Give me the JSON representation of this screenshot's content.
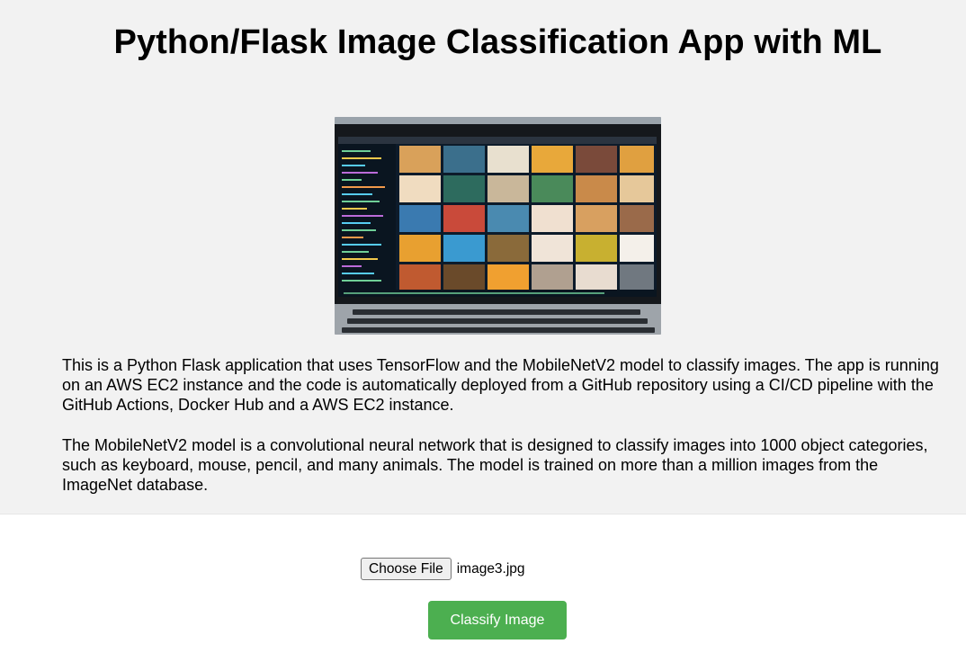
{
  "header": {
    "title": "Python/Flask Image Classification App with ML"
  },
  "hero_image": {
    "description_icon": "laptop-image-grid"
  },
  "description": {
    "paragraph_1": "This is a Python Flask application that uses TensorFlow and the MobileNetV2 model to classify images. The app is running on an AWS EC2 instance and the code is automatically deployed from a GitHub repository using a CI/CD pipeline with the GitHub Actions, Docker Hub and a AWS EC2 instance.",
    "paragraph_2": "The MobileNetV2 model is a convolutional neural network that is designed to classify images into 1000 object categories, such as keyboard, mouse, pencil, and many animals. The model is trained on more than a million images from the ImageNet database."
  },
  "form": {
    "choose_file_label": "Choose File",
    "selected_file": "image3.jpg",
    "classify_label": "Classify Image"
  },
  "colors": {
    "header_background": "#f2f2f2",
    "classify_button": "#4caf50"
  }
}
